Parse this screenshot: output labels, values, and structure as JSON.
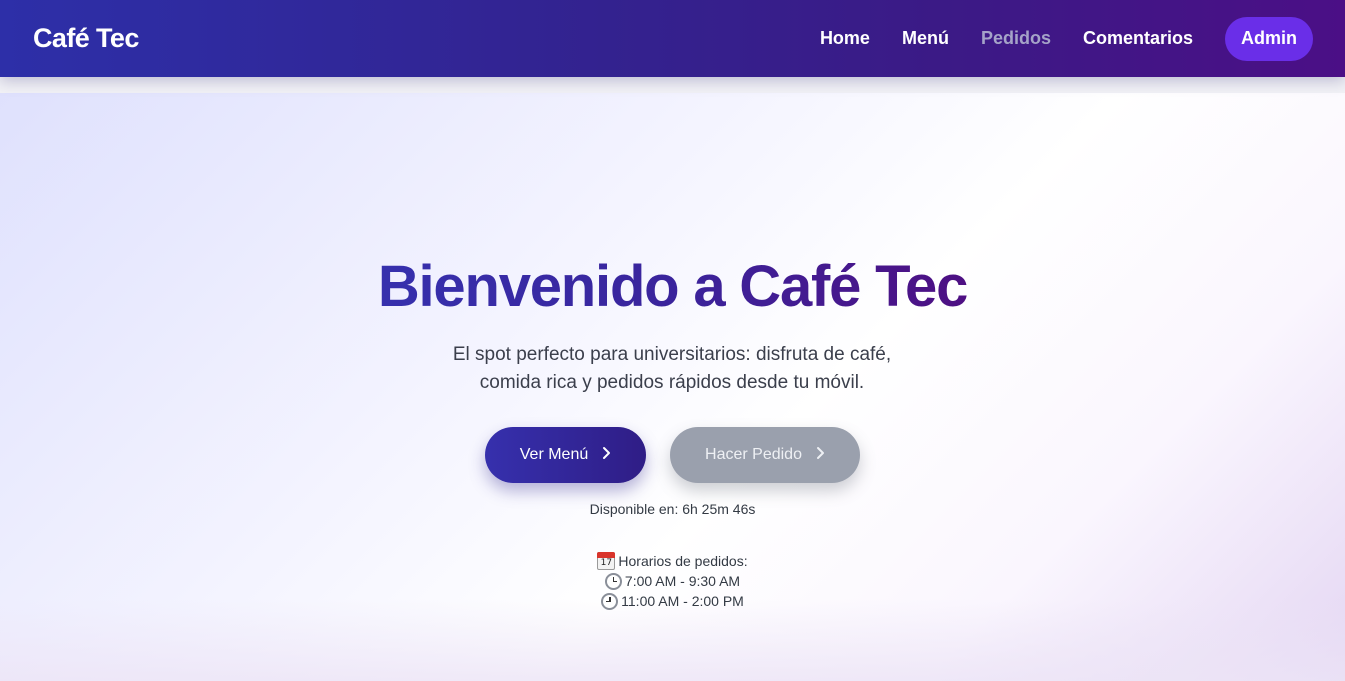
{
  "header": {
    "brand": "Café Tec",
    "nav": {
      "home": "Home",
      "menu": "Menú",
      "orders": "Pedidos",
      "comments": "Comentarios",
      "admin": "Admin"
    }
  },
  "hero": {
    "title": "Bienvenido a Café Tec",
    "subtitle": "El spot perfecto para universitarios: disfruta de café, comida rica y pedidos rápidos desde tu móvil.",
    "buttons": {
      "menu": "Ver Menú",
      "order": "Hacer Pedido"
    },
    "countdown": "Disponible en: 6h 25m 46s",
    "schedule": {
      "title": "Horarios de pedidos:",
      "slots": [
        "7:00 AM - 9:30 AM",
        "11:00 AM - 2:00 PM"
      ]
    }
  },
  "icons": {
    "calendar": "calendar-icon",
    "clock": "clock-icon",
    "chevron": "chevron-right-icon"
  },
  "colors": {
    "nav_gradient_start": "#2d2fa8",
    "nav_gradient_end": "#4b0f86",
    "admin_button": "#6a2ee8",
    "primary_button": "#3630ad",
    "disabled_button": "#9aa0ad",
    "nav_link_muted": "#a5a3c8"
  }
}
